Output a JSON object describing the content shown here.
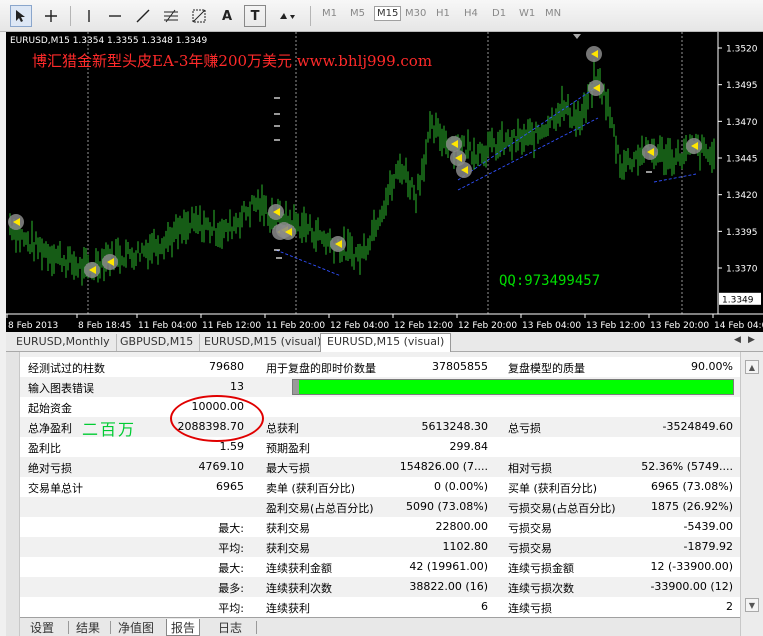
{
  "toolbar": {
    "icons": [
      "cursor-icon",
      "crosshair-icon",
      "vertical-line-icon",
      "horizontal-line-icon",
      "trendline-icon",
      "fibonacci-icon",
      "fibonacci-grid-icon",
      "text-icon",
      "text-label-icon",
      "arrows-icon"
    ],
    "text_tool": "A",
    "label_tool": "T",
    "timeframes": [
      "M1",
      "M5",
      "M15",
      "M30",
      "H1",
      "H4",
      "D1",
      "W1",
      "MN"
    ],
    "active_timeframe": "M15"
  },
  "chart": {
    "header": "EURUSD,M15  1.3354 1.3355 1.3348 1.3349",
    "ad_title": "博汇猎金新型头皮EA-3年赚200万美元   www.bhlj999.com",
    "qq": "QQ:973499457",
    "current_price": "1.3349",
    "price_ticks": [
      "1.3520",
      "1.3495",
      "1.3470",
      "1.3445",
      "1.3420",
      "1.3395",
      "1.3370"
    ],
    "time_ticks": [
      "8 Feb 2013",
      "8 Feb 18:45",
      "11 Feb 04:00",
      "11 Feb 12:00",
      "11 Feb 20:00",
      "12 Feb 04:00",
      "12 Feb 12:00",
      "12 Feb 20:00",
      "13 Feb 04:00",
      "13 Feb 12:00",
      "13 Feb 20:00",
      "14 Feb 04:00"
    ],
    "colors": {
      "background": "#000000",
      "bars": "#2db82d",
      "text": "#ffffff",
      "ad": "#ff2a2a",
      "qq": "#00dd00"
    }
  },
  "chart_tabs": [
    "EURUSD,Monthly",
    "GBPUSD,M15",
    "EURUSD,M15 (visual)",
    "EURUSD,M15 (visual)"
  ],
  "report": {
    "rows": [
      {
        "c1": "经测试过的柱数",
        "v1": "79680",
        "c2": "用于复盘的即时价数量",
        "v2": "37805855",
        "c3": "复盘模型的质量",
        "v3": "90.00%"
      },
      {
        "c1": "输入图表错误",
        "v1": "13"
      },
      {
        "c1": "起始资金",
        "v1": "10000.00"
      },
      {
        "c1": "总净盈利",
        "v1": "2088398.70",
        "c2": "总获利",
        "v2": "5613248.30",
        "c3": "总亏损",
        "v3": "-3524849.60"
      },
      {
        "c1": "盈利比",
        "v1": "1.59",
        "c2": "预期盈利",
        "v2": "299.84"
      },
      {
        "c1": "绝对亏损",
        "v1": "4769.10",
        "c2": "最大亏损",
        "v2": "154826.00 (7....",
        "c3": "相对亏损",
        "v3": "52.36% (5749...."
      },
      {
        "c1": "交易单总计",
        "v1": "6965",
        "c2": "卖单 (获利百分比)",
        "v2": "0 (0.00%)",
        "c3": "买单 (获利百分比)",
        "v3": "6965 (73.08%)"
      },
      {
        "c2": "盈利交易(占总百分比)",
        "v2": "5090 (73.08%)",
        "c3": "亏损交易(占总百分比)",
        "v3": "1875 (26.92%)"
      },
      {
        "c1": "最大:",
        "c2": "获利交易",
        "v2": "22800.00",
        "c3": "亏损交易",
        "v3": "-5439.00"
      },
      {
        "c1": "平均:",
        "c2": "获利交易",
        "v2": "1102.80",
        "c3": "亏损交易",
        "v3": "-1879.92"
      },
      {
        "c1": "最大:",
        "c2": "连续获利金额",
        "v2": "42 (19961.00)",
        "c3": "连续亏损金额",
        "v3": "12 (-33900.00)"
      },
      {
        "c1": "最多:",
        "c2": "连续获利次数",
        "v2": "38822.00 (16)",
        "c3": "连续亏损次数",
        "v3": "-33900.00 (12)"
      },
      {
        "c1": "平均:",
        "c2": "连续获利",
        "v2": "6",
        "c3": "连续亏损",
        "v3": "2"
      }
    ],
    "quality_pct": 90
  },
  "annotation": {
    "text": "二百万",
    "circle_color": "#e00000",
    "text_color": "#00cc33"
  },
  "bottom_tabs": [
    "设置",
    "结果",
    "净值图",
    "报告",
    "日志"
  ],
  "active_bottom_tab": "报告"
}
